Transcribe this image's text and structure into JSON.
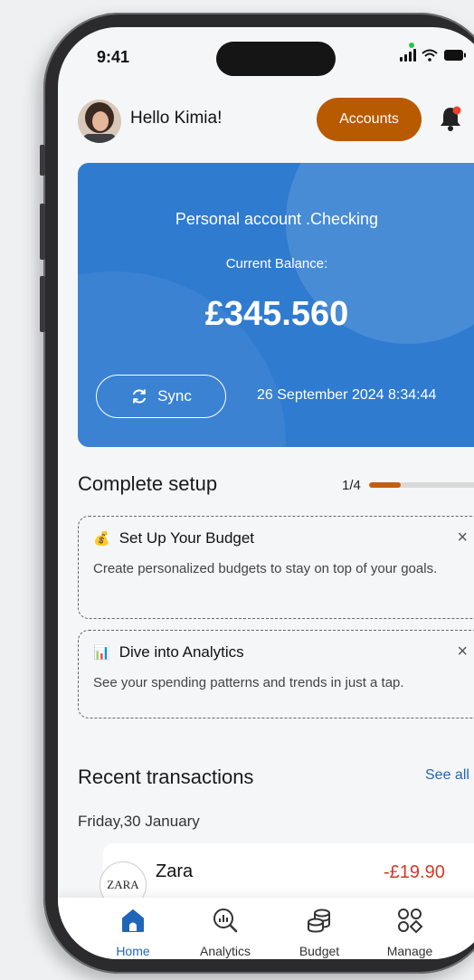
{
  "status_bar": {
    "time": "9:41"
  },
  "header": {
    "greeting": "Hello Kimia!",
    "accounts_button": "Accounts"
  },
  "balance_card": {
    "account_name": "Personal account .Checking",
    "balance_label": "Current Balance:",
    "balance": "£345.560",
    "sync_label": "Sync",
    "timestamp": "26 September 2024 8:34:44"
  },
  "setup": {
    "title": "Complete setup",
    "progress_text": "1/4",
    "progress_fraction": 0.25,
    "items": [
      {
        "emoji": "💰",
        "title": "Set Up Your Budget",
        "close": "×",
        "description": "Create personalized budgets to stay on top of your goals."
      },
      {
        "emoji": "📊",
        "title": "Dive into Analytics",
        "close": "×",
        "description": "See your spending patterns and trends in just a tap."
      }
    ]
  },
  "transactions": {
    "title": "Recent transactions",
    "see_all": "See all",
    "date_header": "Friday,30 January",
    "items": [
      {
        "merchant": "Zara",
        "logo_text": "ZARA",
        "amount": "-£19.90"
      }
    ]
  },
  "tab_bar": {
    "tabs": [
      {
        "label": "Home",
        "icon": "home-icon",
        "active": true
      },
      {
        "label": "Analytics",
        "icon": "analytics-icon",
        "active": false
      },
      {
        "label": "Budget",
        "icon": "budget-icon",
        "active": false
      },
      {
        "label": "Manage",
        "icon": "manage-icon",
        "active": false
      }
    ]
  },
  "colors": {
    "accent": "#b75a00",
    "card_blue": "#2f7bd0",
    "active_tab": "#1f66b8",
    "negative": "#d23a22"
  }
}
